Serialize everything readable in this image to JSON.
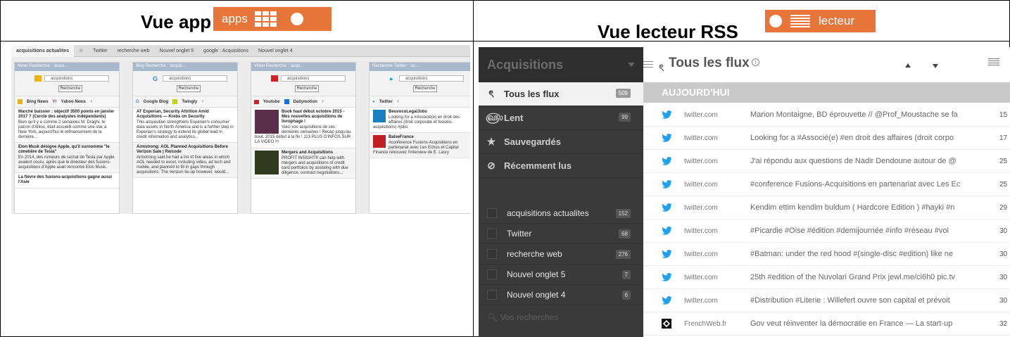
{
  "left_panel": {
    "title": "Vue app",
    "pill_label": "apps",
    "app": {
      "tabs": [
        "acquisitions actualites",
        "Twitter",
        "recherche web",
        "Nouvel onglet 5",
        "google : Acquisitions",
        "Nouvel onglet 4"
      ],
      "columns": [
        {
          "header": "News Recherche : 'acqui...",
          "query": "acquisitions",
          "button": "Recherche",
          "sources": [
            "Bing News",
            "Yahoo News"
          ],
          "items": [
            {
              "title": "Marché baissier : objectif 3500 points en janvier 2017 ? (Cercle des analystes indépendants)",
              "body": "Bien qu'il y a comme 2 semaines M. Draghi, le patron d'Alitoc, était accueilli comme une star à New York, aujourd'hui le refinancement de la dernière..."
            },
            {
              "title": "Elon Musk désigne Apple, qu'il surnomme \"le cimetière de Tesla\"",
              "body": "En 2014, des rumeurs de rachat de Tesla par Apple avaient couru, après que le directeur des fusions-acquisitions d'Apple avait rencontré Elon Musk."
            },
            {
              "title": "La fièvre des fusions-acquisitions gagne aussi l'Asie",
              "body": ""
            }
          ]
        },
        {
          "header": "Blog Recherche : 'acquis...",
          "query": "acquisitions",
          "button": "Recherche",
          "sources": [
            "Google Blog",
            "Twingly"
          ],
          "items": [
            {
              "title": "AT Experian, Security Attrition Amid Acquisitions — Krebs on Security",
              "body": "This acquisition strengthens Experian's consumer data assets in North America and is a further step in Experian's strategy to extend its global lead in credit information and analytics..."
            },
            {
              "title": "Armstrong: AOL Planned Acquisitions Before Verizon Sale | Re/code",
              "body": "Armstrong said he had a list of five areas in which AOL needed to excel, including video, ad tech and mobile, and planned to fill in gaps through acquisitions. The Verizon tie-up however, would..."
            }
          ]
        },
        {
          "header": "Video Recherche : 'acqu...",
          "query": "acquisitions",
          "button": "Recherche",
          "sources": [
            "Youtube",
            "Dailymotion"
          ],
          "items": [
            {
              "title": "Book haul début octobre 2015 - Mes nouvelles acquisitions de livrophage !",
              "body": "Voici vos acquisitions de ces dernières semaines ! Recap jusqu'au bout. 2015 début à la fin ! 113 PLUS D'INFOS SUR LA VIDEO !!!"
            },
            {
              "title": "Mergers and Acquisitions",
              "body": "PROFIT INSIGHT® can help with mergers and acquisitions of credit card portfolios by assisting with due diligence, contract negotiations..."
            }
          ]
        },
        {
          "header": "Recherche Twitter : 'ac...",
          "query": "acquisitions",
          "button": "Recherche",
          "sources": [
            "Twitter"
          ],
          "items": [
            {
              "title": "BeuvocoLegalJobs",
              "body": "Looking for a #Associé(e) en droit des affaires (droit corporate et fusions-acquisitions) #jobs"
            },
            {
              "title": "BalseFrance",
              "body": "#conference Fusions-Acquisitions en partenariat avec Les Echos et Capital Finance retrouvez l'interview de E. Lasry"
            }
          ]
        }
      ]
    }
  },
  "right_panel": {
    "title": "Vue lecteur RSS",
    "pill_label": "lecteur",
    "sidebar": {
      "title": "Acquisitions",
      "nav": [
        {
          "label": "Tous les flux",
          "count": "509",
          "icon": "rss-icon",
          "selected": true
        },
        {
          "label": "Lent",
          "count": "99",
          "icon": "snail-icon"
        },
        {
          "label": "Sauvegardés",
          "count": "",
          "icon": "star-icon"
        },
        {
          "label": "Récemment lus",
          "count": "",
          "icon": "check-circle-icon"
        }
      ],
      "feeds": [
        {
          "label": "acquisitions actualites",
          "count": "152"
        },
        {
          "label": "Twitter",
          "count": "68"
        },
        {
          "label": "recherche web",
          "count": "276"
        },
        {
          "label": "Nouvel onglet 5",
          "count": "7"
        },
        {
          "label": "Nouvel onglet 4",
          "count": "6"
        }
      ],
      "search_placeholder": "Vos recherches"
    },
    "main": {
      "title": "Tous les flux",
      "section": "AUJOURD'HUI",
      "items": [
        {
          "source": "twitter.com",
          "text": "Marion Montaigne, BD éprouvette // @Prof_Moustache se fa",
          "num": "15",
          "icon": "twitter-bird-icon"
        },
        {
          "source": "twitter.com",
          "text": "Looking for a #Associé(e) #en droit des affaires (droit corpo",
          "num": "17",
          "icon": "twitter-bird-icon"
        },
        {
          "source": "twitter.com",
          "text": "J'ai répondu aux questions de Nadir Dendoune autour de @",
          "num": "25",
          "icon": "twitter-bird-icon"
        },
        {
          "source": "twitter.com",
          "text": "#conference Fusions-Acquisitions en partenariat avec Les Ec",
          "num": "25",
          "icon": "twitter-bird-icon"
        },
        {
          "source": "twitter.com",
          "text": "Kendim ettim kendim buldum ( Hardcore Edition ) #hayki #n",
          "num": "29",
          "icon": "twitter-bird-icon"
        },
        {
          "source": "twitter.com",
          "text": "#Picardie #Oise #édition #demijournée #info #réseau #vol",
          "num": "30",
          "icon": "twitter-bird-icon"
        },
        {
          "source": "twitter.com",
          "text": "#Batman: under the red hood #(single-disc #edition) like ne",
          "num": "30",
          "icon": "twitter-bird-icon"
        },
        {
          "source": "twitter.com",
          "text": "25th #edition of the Nuvolari Grand Prix jewl.me/ci6h0 pic.tv",
          "num": "30",
          "icon": "twitter-bird-icon"
        },
        {
          "source": "twitter.com",
          "text": "#Distribution #Literie : Willefert ouvre son capital et prévoit",
          "num": "30",
          "icon": "twitter-bird-icon"
        },
        {
          "source": "FrenchWeb.fr",
          "text": "Gov veut réinventer la démocratie en France — La start-up",
          "num": "32",
          "icon": "frenchweb-icon"
        }
      ]
    }
  },
  "colors": {
    "accent": "#e8763a",
    "twitter": "#1da1f2",
    "sidebar_bg": "#3a3a3a",
    "day_bar": "#c9c9c9"
  }
}
